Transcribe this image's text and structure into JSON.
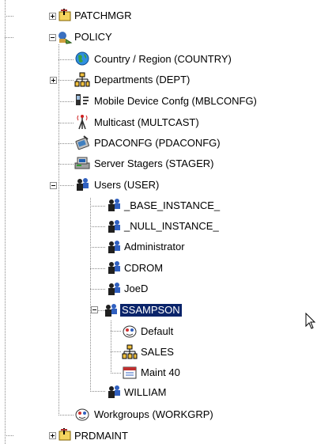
{
  "tree": {
    "nodes": [
      {
        "label": "PATCHMGR",
        "icon": "folder-tools-icon"
      },
      {
        "label": "POLICY",
        "icon": "policy-icon"
      },
      {
        "label": "Country / Region (COUNTRY)",
        "icon": "globe-icon"
      },
      {
        "label": "Departments (DEPT)",
        "icon": "org-chart-icon"
      },
      {
        "label": "Mobile Device Confg (MBLCONFG)",
        "icon": "mobile-config-icon"
      },
      {
        "label": "Multicast (MULTCAST)",
        "icon": "antenna-icon"
      },
      {
        "label": "PDACONFG (PDACONFG)",
        "icon": "pda-icon"
      },
      {
        "label": "Server Stagers (STAGER)",
        "icon": "server-stager-icon"
      },
      {
        "label": "Users (USER)",
        "icon": "users-icon"
      },
      {
        "label": "_BASE_INSTANCE_",
        "icon": "user-icon"
      },
      {
        "label": "_NULL_INSTANCE_",
        "icon": "user-icon"
      },
      {
        "label": "Administrator",
        "icon": "user-icon"
      },
      {
        "label": "CDROM",
        "icon": "user-icon"
      },
      {
        "label": "JoeD",
        "icon": "user-icon"
      },
      {
        "label": "SSAMPSON",
        "icon": "user-icon",
        "selected": true
      },
      {
        "label": "Default",
        "icon": "workgroup-icon"
      },
      {
        "label": "SALES",
        "icon": "org-chart-icon"
      },
      {
        "label": "Maint 40",
        "icon": "calendar-icon"
      },
      {
        "label": "WILLIAM",
        "icon": "user-icon"
      },
      {
        "label": "Workgroups (WORKGRP)",
        "icon": "workgroup-icon"
      },
      {
        "label": "PRDMAINT",
        "icon": "folder-tools-icon"
      }
    ]
  },
  "colors": {
    "selection": "#0a246a",
    "tree_lines": "#8a8a8a"
  }
}
